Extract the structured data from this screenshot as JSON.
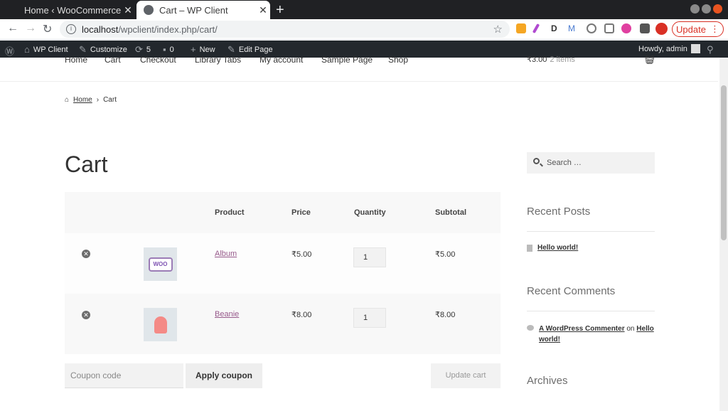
{
  "browser": {
    "tabs": [
      {
        "title": "Home ‹ WooCommerce ‹ W"
      },
      {
        "title": "Cart – WP Client"
      }
    ],
    "url_host": "localhost",
    "url_path": "/wpclient/index.php/cart/",
    "update_label": "Update"
  },
  "adminbar": {
    "site_name": "WP Client",
    "customize": "Customize",
    "updates_count": "5",
    "comments_count": "0",
    "new": "New",
    "edit_page": "Edit Page",
    "howdy": "Howdy, admin"
  },
  "nav": {
    "items": [
      "Home",
      "Cart",
      "Checkout",
      "Library Tabs",
      "My account",
      "Sample Page",
      "Shop"
    ],
    "cart_total": "₹3.00",
    "cart_items": "2 items"
  },
  "breadcrumb": {
    "home": "Home",
    "current": "Cart"
  },
  "page_title": "Cart",
  "cart": {
    "headers": {
      "product": "Product",
      "price": "Price",
      "quantity": "Quantity",
      "subtotal": "Subtotal"
    },
    "rows": [
      {
        "name": "Album",
        "price": "₹5.00",
        "qty": "1",
        "subtotal": "₹5.00",
        "thumb_icon": "woo-album-thumbnail"
      },
      {
        "name": "Beanie",
        "price": "₹8.00",
        "qty": "1",
        "subtotal": "₹8.00",
        "thumb_icon": "beanie-thumbnail"
      }
    ],
    "coupon_placeholder": "Coupon code",
    "apply_coupon": "Apply coupon",
    "update_cart": "Update cart"
  },
  "sidebar": {
    "search_placeholder": "Search …",
    "recent_posts_title": "Recent Posts",
    "recent_post": "Hello world!",
    "recent_comments_title": "Recent Comments",
    "comment_author": "A WordPress Commenter",
    "comment_on": "on",
    "comment_post_line1": "Hello",
    "comment_post_line2": "world!",
    "archives_title": "Archives"
  },
  "colors": {
    "link": "#96588a",
    "adminbar": "#23282d",
    "update": "#d93025"
  }
}
